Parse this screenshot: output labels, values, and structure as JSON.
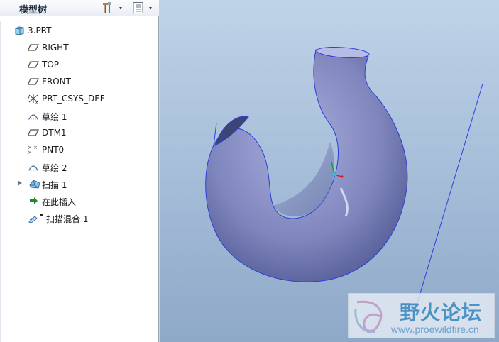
{
  "panel": {
    "title": "模型树"
  },
  "tree": {
    "items": [
      {
        "label": "3.PRT",
        "icon": "part-icon"
      },
      {
        "label": "RIGHT",
        "icon": "datum-plane-icon"
      },
      {
        "label": "TOP",
        "icon": "datum-plane-icon"
      },
      {
        "label": "FRONT",
        "icon": "datum-plane-icon"
      },
      {
        "label": "PRT_CSYS_DEF",
        "icon": "coordinate-system-icon"
      },
      {
        "label": "草绘 1",
        "icon": "sketch-icon"
      },
      {
        "label": "DTM1",
        "icon": "datum-plane-icon"
      },
      {
        "label": "PNT0",
        "icon": "datum-point-icon"
      },
      {
        "label": "草绘 2",
        "icon": "sketch-icon"
      },
      {
        "label": "扫描 1",
        "icon": "sweep-icon"
      },
      {
        "label": "在此插入",
        "icon": "insert-here-arrow-icon"
      },
      {
        "label": "扫描混合 1",
        "icon": "swept-blend-icon"
      }
    ]
  },
  "watermark": {
    "name": "野火论坛",
    "url": "www.proewildfire.cn"
  },
  "colors": {
    "panel_bg": "#ffffff",
    "viewport_top": "#bfd3e8",
    "viewport_bottom": "#8ea8c8",
    "model": "#8a90c4",
    "model_edge": "#2b3fd6"
  }
}
